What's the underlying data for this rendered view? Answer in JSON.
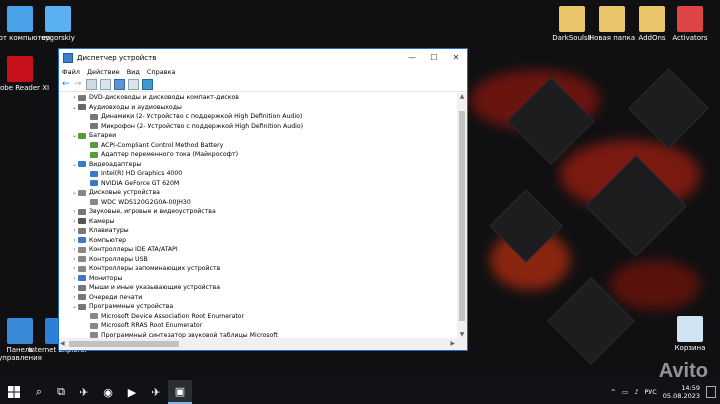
{
  "desktop": {
    "icons_left": [
      {
        "label": "Этот компьютер",
        "icon": "computer-icon",
        "color": "#4aa3e8"
      },
      {
        "label": "ovgorskiy",
        "icon": "user-folder-icon",
        "color": "#5ab0f0"
      },
      {
        "label": "Adobe Reader XI",
        "icon": "adobe-icon",
        "color": "#c8101a"
      },
      {
        "label": "Панель управления",
        "icon": "control-panel-icon",
        "color": "#3a8ad8"
      },
      {
        "label": "Internet Explorer",
        "icon": "ie-icon",
        "color": "#2d7fd8"
      }
    ],
    "icons_right": [
      {
        "label": "DarkSoulsII",
        "icon": "folder-icon",
        "color": "#e8c56a"
      },
      {
        "label": "Новая папка",
        "icon": "folder-icon",
        "color": "#e8c56a"
      },
      {
        "label": "AddOns",
        "icon": "folder-icon",
        "color": "#e8c56a"
      },
      {
        "label": "Activators",
        "icon": "activators-icon",
        "color": "#d44"
      },
      {
        "label": "Корзина",
        "icon": "recycle-bin-icon",
        "color": "#cfe3f2"
      }
    ]
  },
  "window": {
    "title": "Диспетчер устройств",
    "controls": {
      "minimize": "—",
      "maximize": "☐",
      "close": "✕"
    },
    "menu": [
      "Файл",
      "Действие",
      "Вид",
      "Справка"
    ],
    "tree": [
      {
        "level": 0,
        "expander": "›",
        "label": "DVD-дисководы и дисководы компакт-дисков",
        "color": "#777"
      },
      {
        "level": 0,
        "expander": "⌄",
        "label": "Аудиовходы и аудиовыходы",
        "color": "#666"
      },
      {
        "level": 1,
        "expander": "",
        "label": "Динамики (2- Устройство с поддержкой High Definition Audio)",
        "color": "#777"
      },
      {
        "level": 1,
        "expander": "",
        "label": "Микрофон (2- Устройство с поддержкой High Definition Audio)",
        "color": "#777"
      },
      {
        "level": 0,
        "expander": "⌄",
        "label": "Батареи",
        "color": "#5a9a3a"
      },
      {
        "level": 1,
        "expander": "",
        "label": "ACPI-Compliant Control Method Battery",
        "color": "#5a9a3a"
      },
      {
        "level": 1,
        "expander": "",
        "label": "Адаптер переменного тока (Майкрософт)",
        "color": "#5a9a3a"
      },
      {
        "level": 0,
        "expander": "⌄",
        "label": "Видеоадаптеры",
        "color": "#3a7ac8"
      },
      {
        "level": 1,
        "expander": "",
        "label": "Intel(R) HD Graphics 4000",
        "color": "#3a7ac8"
      },
      {
        "level": 1,
        "expander": "",
        "label": "NVIDIA GeForce GT 620M",
        "color": "#3a7ac8"
      },
      {
        "level": 0,
        "expander": "⌄",
        "label": "Дисковые устройства",
        "color": "#888"
      },
      {
        "level": 1,
        "expander": "",
        "label": "WDC WDS120G2G0A-00JH30",
        "color": "#888"
      },
      {
        "level": 0,
        "expander": "›",
        "label": "Звуковые, игровые и видеоустройства",
        "color": "#777"
      },
      {
        "level": 0,
        "expander": "›",
        "label": "Камеры",
        "color": "#555"
      },
      {
        "level": 0,
        "expander": "›",
        "label": "Клавиатуры",
        "color": "#777"
      },
      {
        "level": 0,
        "expander": "›",
        "label": "Компьютер",
        "color": "#3a7ac8"
      },
      {
        "level": 0,
        "expander": "›",
        "label": "Контроллеры IDE ATA/ATAPI",
        "color": "#888"
      },
      {
        "level": 0,
        "expander": "›",
        "label": "Контроллеры USB",
        "color": "#888"
      },
      {
        "level": 0,
        "expander": "›",
        "label": "Контроллеры запоминающих устройств",
        "color": "#888"
      },
      {
        "level": 0,
        "expander": "›",
        "label": "Мониторы",
        "color": "#3a7ac8"
      },
      {
        "level": 0,
        "expander": "›",
        "label": "Мыши и иные указывающие устройства",
        "color": "#777"
      },
      {
        "level": 0,
        "expander": "›",
        "label": "Очереди печати",
        "color": "#777"
      },
      {
        "level": 0,
        "expander": "⌄",
        "label": "Программные устройства",
        "color": "#777"
      },
      {
        "level": 1,
        "expander": "",
        "label": "Microsoft Device Association Root Enumerator",
        "color": "#888"
      },
      {
        "level": 1,
        "expander": "",
        "label": "Microsoft RRAS Root Enumerator",
        "color": "#888"
      },
      {
        "level": 1,
        "expander": "",
        "label": "Программный синтезатор звуковой таблицы Microsoft",
        "color": "#888"
      }
    ]
  },
  "taskbar": {
    "start_icon": "windows-start-icon",
    "items": [
      {
        "name": "search-icon",
        "glyph": "⌕"
      },
      {
        "name": "task-view-icon",
        "glyph": "⧉"
      },
      {
        "name": "telegram-icon",
        "glyph": "✈"
      },
      {
        "name": "chrome-icon",
        "glyph": "◉"
      },
      {
        "name": "media-player-icon",
        "glyph": "▶"
      },
      {
        "name": "telegram-icon-2",
        "glyph": "✈"
      },
      {
        "name": "device-manager-taskbar-icon",
        "glyph": "▣"
      }
    ],
    "tray": {
      "chevron": "^",
      "language": "РУС",
      "time": "14:59",
      "date": "05.08.2023"
    }
  },
  "watermark": "Avito"
}
